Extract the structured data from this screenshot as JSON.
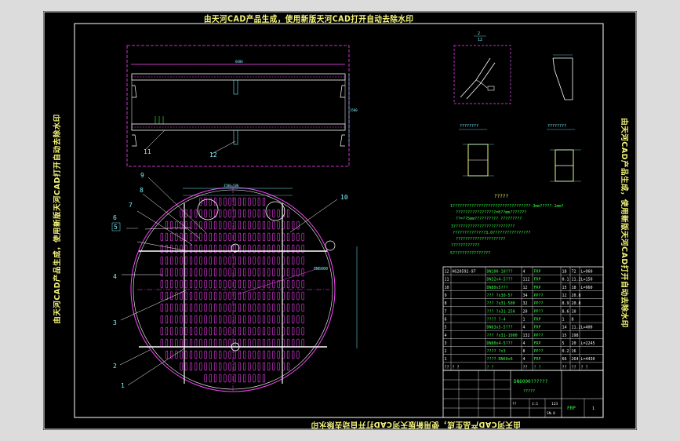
{
  "watermark": {
    "top": "由天河CAD产品生成，使用新版天河CAD打开自动去除水印",
    "bottom": "由天河CAD产品生成，使用新版天河CAD打开自动去除水印",
    "left": "由天河CAD产品生成，使用新版天河CAD打开自动去除水印",
    "right": "由天河CAD产品生成，使用新版天河CAD打开自动去除水印"
  },
  "callouts": [
    "1",
    "2",
    "3",
    "4",
    "5",
    "6",
    "7",
    "8",
    "9",
    "10",
    "11",
    "12"
  ],
  "section_labels": {
    "detail_a": "2",
    "detail_a_sub": "12",
    "section_b": "????????",
    "section_c": "????????",
    "notes_title": "?????"
  },
  "notes": [
    "1?????????????????????????????????-3mm?????-1mm?",
    "?????????????????=0??mm???????",
    "??=??5mm?????????? ?????????",
    "3??????????????????????????",
    "??????????????3.0????????????????",
    "?????????????????????",
    "????????????",
    "5????????????????"
  ],
  "parts_table": {
    "rows": [
      {
        "no": "12",
        "code": "HG20592-97",
        "name": "DN100-10???",
        "qty": "4",
        "mat": "FRP",
        "w1": "18",
        "w2": "72",
        "note": "L=960"
      },
      {
        "no": "11",
        "code": "",
        "name": "DN32x4-5???",
        "qty": "112",
        "mat": "FRP",
        "w1": "0.1",
        "w2": "11.2",
        "note": "L=150"
      },
      {
        "no": "10",
        "code": "",
        "name": "DN80x5???",
        "qty": "12",
        "mat": "FRP",
        "w1": "15",
        "w2": "18",
        "note": "L=960"
      },
      {
        "no": "9",
        "code": "",
        "name": "??? ?x30-5?",
        "qty": "34",
        "mat": "PP??",
        "w1": "12",
        "w2": "20.8",
        "note": ""
      },
      {
        "no": "8",
        "code": "",
        "name": "??? ?x31-500",
        "qty": "32",
        "mat": "PP??",
        "w1": "8.9",
        "w2": "20.8",
        "note": ""
      },
      {
        "no": "7",
        "code": "",
        "name": "??? ?x31-250",
        "qty": "20",
        "mat": "PP??",
        "w1": "8.6",
        "w2": "10",
        "note": ""
      },
      {
        "no": "6",
        "code": "",
        "name": "???? ?-4",
        "qty": "1",
        "mat": "FRP",
        "w1": "1",
        "w2": "8",
        "note": ""
      },
      {
        "no": "5",
        "code": "",
        "name": "DN63x5-5???",
        "qty": "4",
        "mat": "FRP",
        "w1": "14",
        "w2": "11.2",
        "note": "L=400"
      },
      {
        "no": "4",
        "code": "",
        "name": "??? ?x31-1000",
        "qty": "132",
        "mat": "PP??",
        "w1": "15",
        "w2": "198",
        "note": ""
      },
      {
        "no": "3",
        "code": "",
        "name": "DN80x4-5???",
        "qty": "4",
        "mat": "FRP",
        "w1": "5",
        "w2": "20",
        "note": "L=2245"
      },
      {
        "no": "2",
        "code": "",
        "name": "???? ?x3",
        "qty": "8",
        "mat": "PP??",
        "w1": "0.2",
        "w2": "16",
        "note": ""
      },
      {
        "no": "1",
        "code": "",
        "name": "???? DN60x6",
        "qty": "4",
        "mat": "FRP",
        "w1": "66",
        "w2": "264",
        "note": "L=4430"
      },
      {
        "no": "??",
        "code": "? ?",
        "name": "? ?",
        "qty": "??",
        "mat": "? ?",
        "w1": "??",
        "w2": "??",
        "note": "? ?"
      }
    ]
  },
  "title_block": {
    "drawing_title": "DN6000??????",
    "drawing_sub": "?????",
    "material": "FRP",
    "sheet": "1",
    "scale": "??",
    "weight": "1:1",
    "count": "SN.8",
    "total": "123"
  }
}
